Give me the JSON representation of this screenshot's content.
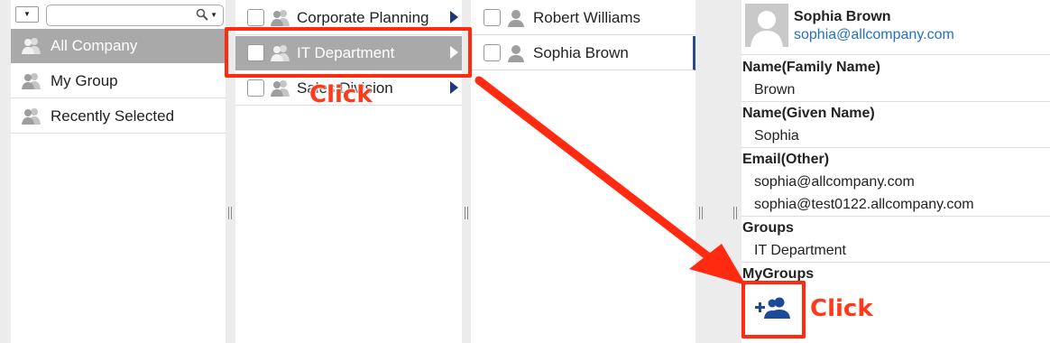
{
  "column1": {
    "items": [
      {
        "label": "All Company",
        "icon": "group-icon",
        "selected": true
      },
      {
        "label": "My Group",
        "icon": "group-icon",
        "selected": false
      },
      {
        "label": "Recently Selected",
        "icon": "group-icon",
        "selected": false
      }
    ]
  },
  "column2": {
    "items": [
      {
        "label": "Corporate Planning"
      },
      {
        "label": "IT Department"
      },
      {
        "label": "Sales Division"
      }
    ]
  },
  "column3": {
    "items": [
      {
        "label": "Robert Williams"
      },
      {
        "label": "Sophia Brown"
      }
    ]
  },
  "profile": {
    "name": "Sophia Brown",
    "email": "sophia@allcompany.com",
    "fields": {
      "family_name_label": "Name(Family Name)",
      "family_name": "Brown",
      "given_name_label": "Name(Given Name)",
      "given_name": "Sophia",
      "email_other_label": "Email(Other)",
      "email_other_1": "sophia@allcompany.com",
      "email_other_2": "sophia@test0122.allcompany.com",
      "groups_label": "Groups",
      "groups_value": "IT Department",
      "mygroups_label": "MyGroups"
    }
  },
  "annotations": {
    "click_1": "Click",
    "click_2": "Click"
  },
  "colors": {
    "selected_row": "#a9a9a9",
    "highlight": "#ff2a10",
    "link": "#2471c4",
    "arrow_icon": "#1c3a7a",
    "add_group_icon": "#1c4a9a"
  }
}
